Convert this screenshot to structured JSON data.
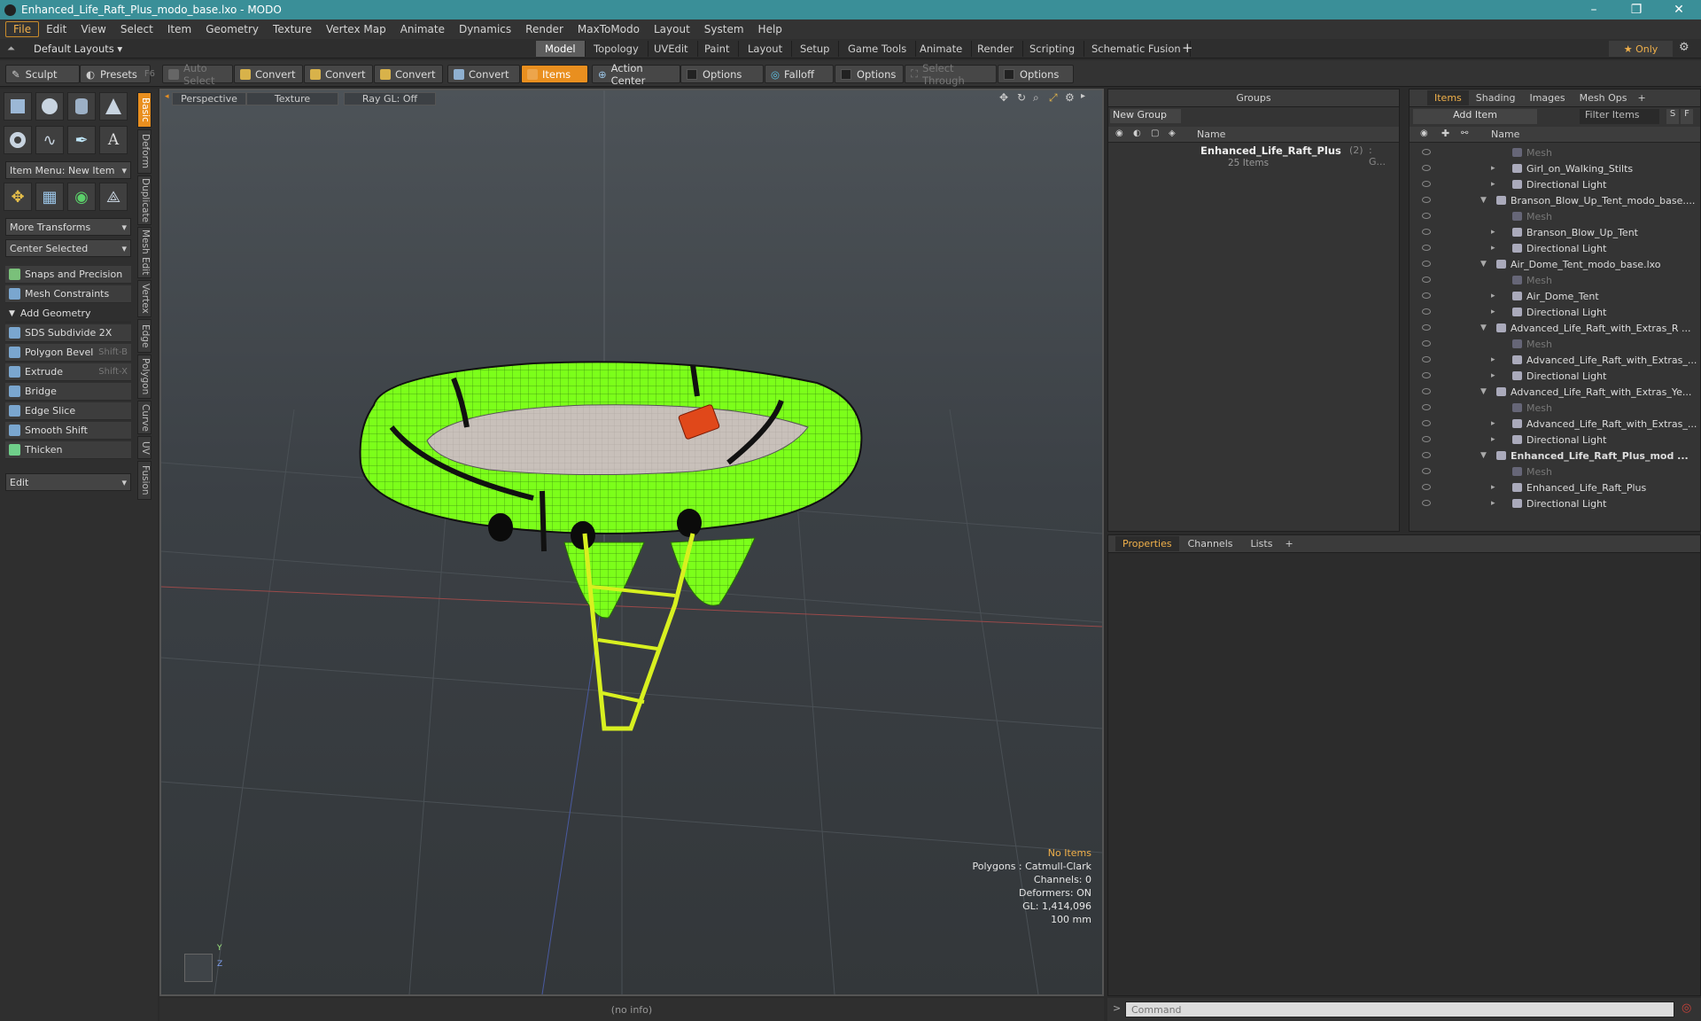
{
  "window": {
    "title": "Enhanced_Life_Raft_Plus_modo_base.lxo - MODO",
    "minimize": "–",
    "maximize": "❐",
    "close": "✕"
  },
  "menu": [
    "File",
    "Edit",
    "View",
    "Select",
    "Item",
    "Geometry",
    "Texture",
    "Vertex Map",
    "Animate",
    "Dynamics",
    "Render",
    "MaxToModo",
    "Layout",
    "System",
    "Help"
  ],
  "layouts": {
    "preset": "Default Layouts ▾",
    "tabs": [
      "Model",
      "Topology",
      "UVEdit",
      "Paint",
      "Layout",
      "Setup",
      "Game Tools",
      "Animate",
      "Render",
      "Scripting",
      "Schematic Fusion"
    ],
    "add": "+",
    "only": "★ Only"
  },
  "toolbar": {
    "sculpt": "Sculpt",
    "presets": "Presets",
    "presets_key": "F6",
    "auto_select": "Auto Select",
    "convert": "Convert",
    "items": "Items",
    "action_center": "Action Center",
    "options": "Options",
    "falloff": "Falloff",
    "select_through": "Select Through"
  },
  "left": {
    "item_menu": "Item Menu: New Item",
    "more_transforms": "More Transforms",
    "center_selected": "Center Selected",
    "snaps": "Snaps and Precision",
    "mesh_constraints": "Mesh Constraints",
    "add_geometry": "Add Geometry",
    "tools": [
      {
        "label": "SDS Subdivide 2X",
        "key": ""
      },
      {
        "label": "Polygon Bevel",
        "key": "Shift-B"
      },
      {
        "label": "Extrude",
        "key": "Shift-X"
      },
      {
        "label": "Bridge",
        "key": ""
      },
      {
        "label": "Edge Slice",
        "key": ""
      },
      {
        "label": "Smooth Shift",
        "key": ""
      },
      {
        "label": "Thicken",
        "key": ""
      }
    ],
    "edit": "Edit",
    "side_tabs": [
      "Basic",
      "Deform",
      "Duplicate",
      "Mesh Edit",
      "Vertex",
      "Edge",
      "Polygon",
      "Curve",
      "UV",
      "Fusion"
    ]
  },
  "viewport": {
    "perspective": "Perspective",
    "texture": "Texture",
    "raygl": "Ray GL: Off",
    "info": {
      "no_items": "No Items",
      "polygons": "Polygons : Catmull-Clark",
      "channels": "Channels: 0",
      "deformers": "Deformers: ON",
      "gl": "GL: 1,414,096",
      "scale": "100 mm"
    },
    "axis_y": "Y",
    "axis_z": "Z",
    "status": "(no info)"
  },
  "groups": {
    "title": "Groups",
    "new_group": "New Group",
    "col_name": "Name",
    "group_name": "Enhanced_Life_Raft_Plus",
    "group_count": "(2)",
    "group_suffix": ": G...",
    "items_count": "25 Items"
  },
  "items_panel": {
    "tabs": [
      "Items",
      "Shading",
      "Images",
      "Mesh Ops"
    ],
    "add": "+",
    "add_item": "Add Item",
    "filter": "Filter Items",
    "s": "S",
    "f": "F",
    "col_name": "Name",
    "rows": [
      {
        "label": "Mesh",
        "indent": 2,
        "dim": true,
        "bold": false
      },
      {
        "label": "Girl_on_Walking_Stilts",
        "indent": 2,
        "dim": false,
        "bold": false
      },
      {
        "label": "Directional Light",
        "indent": 2,
        "dim": false,
        "bold": false
      },
      {
        "label": "Branson_Blow_Up_Tent_modo_base....",
        "indent": 1,
        "dim": false,
        "bold": false
      },
      {
        "label": "Mesh",
        "indent": 2,
        "dim": true,
        "bold": false
      },
      {
        "label": "Branson_Blow_Up_Tent",
        "indent": 2,
        "dim": false,
        "bold": false
      },
      {
        "label": "Directional Light",
        "indent": 2,
        "dim": false,
        "bold": false
      },
      {
        "label": "Air_Dome_Tent_modo_base.lxo",
        "indent": 1,
        "dim": false,
        "bold": false
      },
      {
        "label": "Mesh",
        "indent": 2,
        "dim": true,
        "bold": false
      },
      {
        "label": "Air_Dome_Tent",
        "indent": 2,
        "dim": false,
        "bold": false
      },
      {
        "label": "Directional Light",
        "indent": 2,
        "dim": false,
        "bold": false
      },
      {
        "label": "Advanced_Life_Raft_with_Extras_R ...",
        "indent": 1,
        "dim": false,
        "bold": false
      },
      {
        "label": "Mesh",
        "indent": 2,
        "dim": true,
        "bold": false
      },
      {
        "label": "Advanced_Life_Raft_with_Extras_...",
        "indent": 2,
        "dim": false,
        "bold": false
      },
      {
        "label": "Directional Light",
        "indent": 2,
        "dim": false,
        "bold": false
      },
      {
        "label": "Advanced_Life_Raft_with_Extras_Ye...",
        "indent": 1,
        "dim": false,
        "bold": false
      },
      {
        "label": "Mesh",
        "indent": 2,
        "dim": true,
        "bold": false
      },
      {
        "label": "Advanced_Life_Raft_with_Extras_...",
        "indent": 2,
        "dim": false,
        "bold": false
      },
      {
        "label": "Directional Light",
        "indent": 2,
        "dim": false,
        "bold": false
      },
      {
        "label": "Enhanced_Life_Raft_Plus_mod ...",
        "indent": 1,
        "dim": false,
        "bold": true
      },
      {
        "label": "Mesh",
        "indent": 2,
        "dim": true,
        "bold": false
      },
      {
        "label": "Enhanced_Life_Raft_Plus",
        "indent": 2,
        "dim": false,
        "bold": false
      },
      {
        "label": "Directional Light",
        "indent": 2,
        "dim": false,
        "bold": false
      }
    ]
  },
  "properties": {
    "tabs": [
      "Properties",
      "Channels",
      "Lists"
    ],
    "add": "+"
  },
  "command": {
    "placeholder": "Command",
    "prompt": ">"
  },
  "colors": {
    "accent": "#e98f1f",
    "title_bar": "#3a8f98",
    "raft_green": "#7cff1a",
    "raft_orange": "#e0481a"
  }
}
